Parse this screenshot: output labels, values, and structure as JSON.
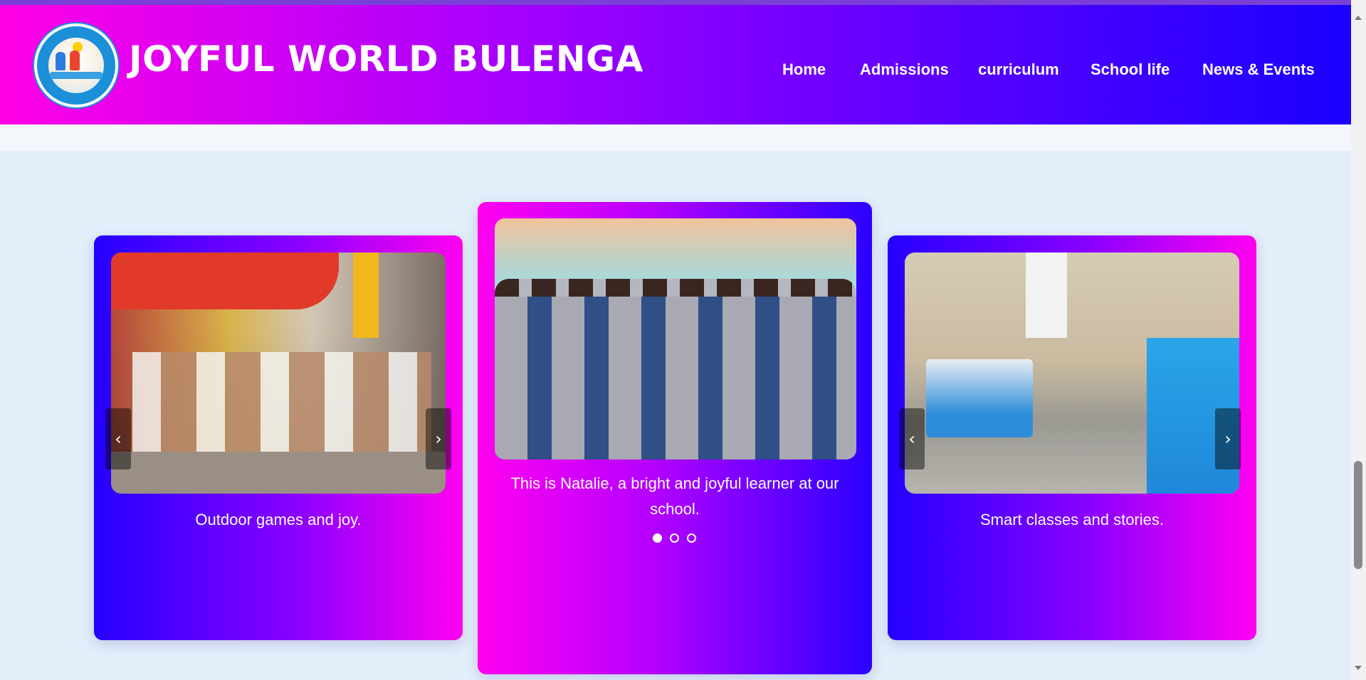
{
  "header": {
    "title": "JOYFUL WORLD BULENGA",
    "logo_icon": "school-crest-logo",
    "nav": [
      {
        "label": "Home"
      },
      {
        "label": "Admissions"
      },
      {
        "label": "curriculum"
      },
      {
        "label": "School life"
      },
      {
        "label": "News & Events"
      }
    ]
  },
  "carousel": {
    "left": {
      "caption": "Outdoor games and joy.",
      "prev_icon": "‹",
      "next_icon": "›"
    },
    "middle": {
      "caption": "This is Natalie, a bright and joyful learner at our school.",
      "active_index": 1,
      "total_slides": 3
    },
    "right": {
      "caption": "Smart classes and stories.",
      "prev_icon": "‹",
      "next_icon": "›"
    }
  },
  "colors": {
    "header_gradient_start": "#ff00e6",
    "header_gradient_end": "#1a00ff",
    "section_bg": "#e2eefa"
  }
}
